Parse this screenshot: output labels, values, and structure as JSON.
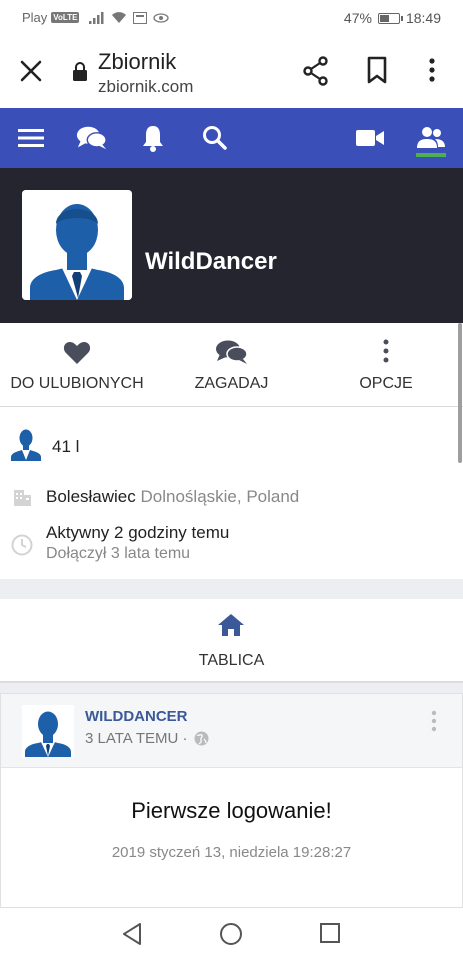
{
  "status_bar": {
    "carrier": "Play",
    "volte": "VoLTE",
    "battery": "47%",
    "battery_level": 0.47,
    "time": "18:49"
  },
  "browser": {
    "title": "Zbiornik",
    "url": "zbiornik.com",
    "icons": [
      "close-icon",
      "lock-icon",
      "share-icon",
      "bookmark-icon",
      "more-vert-icon"
    ]
  },
  "site_nav": {
    "icons": [
      "menu-icon",
      "chat-icon",
      "bell-icon",
      "search-icon",
      "video-icon",
      "people-icon"
    ],
    "active_color": "#4caf50",
    "bar_color": "#3b4fb8"
  },
  "profile": {
    "username": "WildDancer",
    "header_color": "#24252f"
  },
  "actions": {
    "favorite_label": "DO ULUBIONYCH",
    "ask_label": "ZAGADAJ",
    "options_label": "OPCJE"
  },
  "info": {
    "age": "41 l",
    "city": "Bolesławiec",
    "region": "Dolnośląskie, Poland",
    "active": "Aktywny 2 godziny temu",
    "joined": "Dołączył 3 lata temu"
  },
  "tab": {
    "label": "TABLICA"
  },
  "post": {
    "author": "WILDDANCER",
    "meta": "3 LATA TEMU ·",
    "title": "Pierwsze logowanie!",
    "date": "2019 styczeń 13, niedziela 19:28:27"
  }
}
